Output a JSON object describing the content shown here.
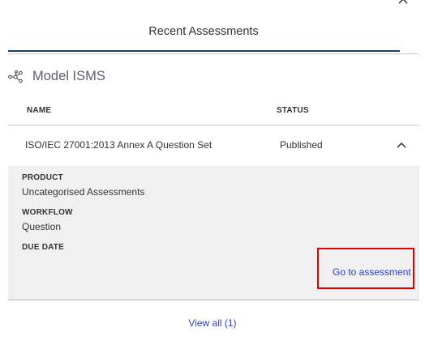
{
  "colors": {
    "accent": "#1f3a6e",
    "link": "#2a3ec4",
    "detail_bg": "#f0f0f0",
    "section_title": "#5b6070",
    "highlight": "#e00000"
  },
  "icons": {
    "close": "close-icon",
    "section": "network-nodes-icon",
    "expand": "chevron-up-icon"
  },
  "panel": {
    "tab_label": "Recent Assessments"
  },
  "section": {
    "title": "Model ISMS"
  },
  "table": {
    "columns": [
      "NAME",
      "STATUS"
    ],
    "rows": [
      {
        "name": "ISO/IEC 27001:2013 Annex A Question Set",
        "status": "Published",
        "expanded": true,
        "details": {
          "product_label": "PRODUCT",
          "product_value": "Uncategorised Assessments",
          "workflow_label": "WORKFLOW",
          "workflow_value": "Question",
          "due_date_label": "DUE DATE",
          "goto_label": "Go to assessment"
        }
      }
    ]
  },
  "footer": {
    "view_all": "View all (1)"
  }
}
